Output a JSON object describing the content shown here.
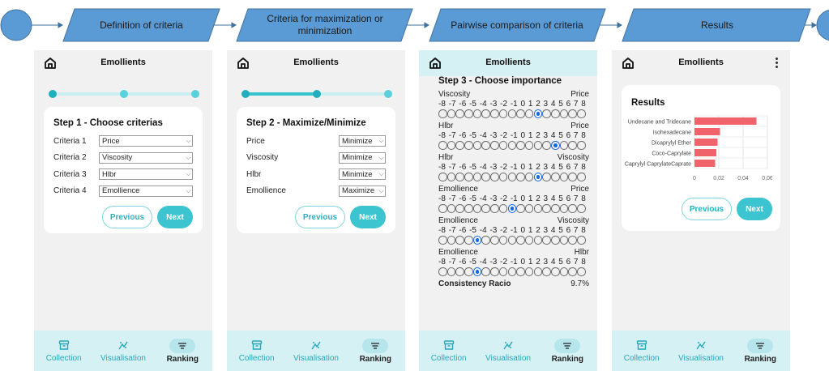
{
  "flow": {
    "steps": [
      "Definition of criteria",
      "Criteria for maximization or minimization",
      "Pairwise comparison of criteria",
      "Results"
    ],
    "colors": {
      "fill": "#5b9bd5",
      "stroke": "#41719c"
    }
  },
  "app": {
    "title": "Emollients",
    "nav": {
      "collection": "Collection",
      "visualisation": "Visualisation",
      "ranking": "Ranking"
    },
    "buttons": {
      "previous": "Previous",
      "next": "Next"
    },
    "accent": "#3cc4d0"
  },
  "step1": {
    "title": "Step 1 - Choose criterias",
    "progress": 0,
    "rows": [
      {
        "label": "Criteria 1",
        "value": "Price"
      },
      {
        "label": "Criteria 2",
        "value": "Viscosity"
      },
      {
        "label": "Criteria 3",
        "value": "Hlbr"
      },
      {
        "label": "Criteria 4",
        "value": "Emollience"
      }
    ]
  },
  "step2": {
    "title": "Step 2 - Maximize/Minimize",
    "progress": 0.5,
    "rows": [
      {
        "label": "Price",
        "value": "Minimize"
      },
      {
        "label": "Viscosity",
        "value": "Minimize"
      },
      {
        "label": "Hlbr",
        "value": "Minimize"
      },
      {
        "label": "Emollience",
        "value": "Maximize"
      }
    ]
  },
  "step3": {
    "title": "Step 3 - Choose importance",
    "scale_labels": [
      "-8",
      "-7",
      "-6",
      "-5",
      "-4",
      "-3",
      "-2",
      "-1",
      "0",
      "1",
      "2",
      "3",
      "4",
      "5",
      "6",
      "7",
      "8"
    ],
    "comparisons": [
      {
        "left": "Viscosity",
        "right": "Price",
        "selected": "3"
      },
      {
        "left": "Hlbr",
        "right": "Price",
        "selected": "5"
      },
      {
        "left": "Hlbr",
        "right": "Viscosity",
        "selected": "3"
      },
      {
        "left": "Emollience",
        "right": "Price",
        "selected": "0"
      },
      {
        "left": "Emollience",
        "right": "Viscosity",
        "selected": "-4"
      },
      {
        "left": "Emollience",
        "right": "Hlbr",
        "selected": "-4"
      }
    ],
    "consistency_label": "Consistency Racio",
    "consistency_value": "9.7%"
  },
  "results": {
    "title": "Results",
    "chart_data": {
      "type": "bar",
      "orientation": "horizontal",
      "categories": [
        "Undecane and Tridecane",
        "Isohexadecane",
        "Dicaprylyl Ether",
        "Coco-Caprylate",
        "Caprylyl CaprylateCaprate"
      ],
      "values": [
        0.051,
        0.021,
        0.019,
        0.018,
        0.017
      ],
      "xlim": [
        0,
        0.06
      ],
      "xticks": [
        "0",
        "0,02",
        "0,04",
        "0,06"
      ],
      "bar_color": "#f0636b",
      "grid": true
    }
  }
}
